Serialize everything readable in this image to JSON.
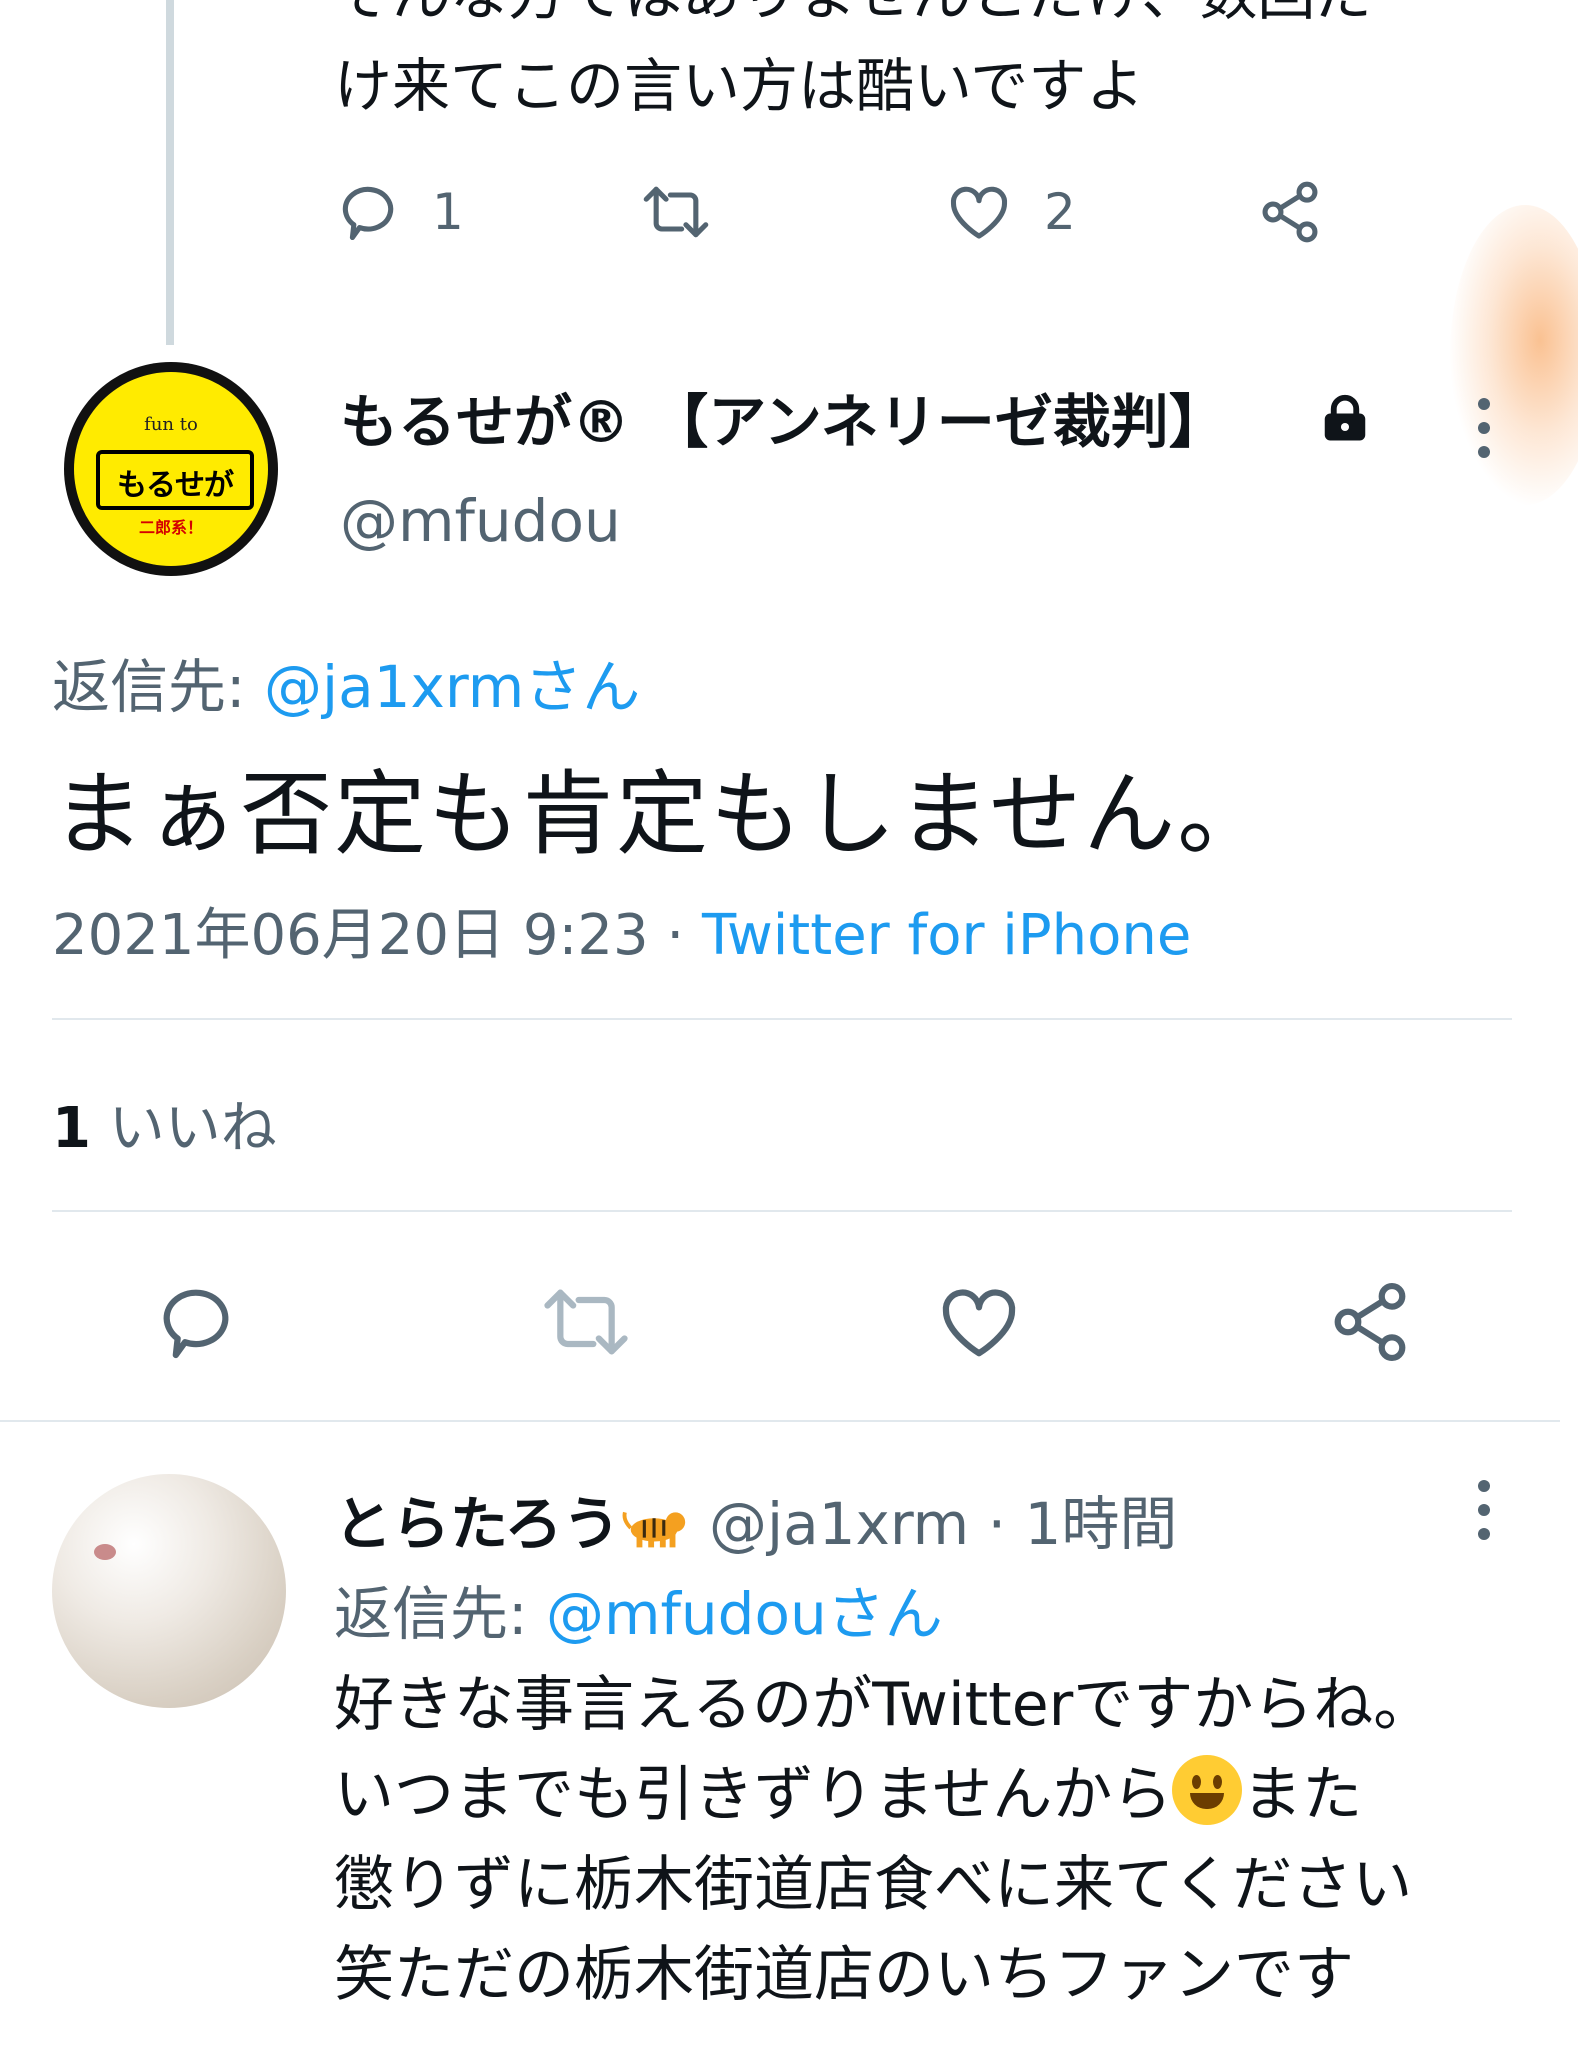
{
  "prev_tweet": {
    "lines": [
      "そんな方ではありませんとだけ、数回だ",
      "け来てこの言い方は酷いですよ"
    ],
    "reply_count": "1",
    "like_count": "2"
  },
  "main_tweet": {
    "display_name": "もるせが® 【アンネリーゼ裁判】",
    "handle": "@mfudou",
    "avatar_text": {
      "top": "fun to",
      "middle": "もるせが",
      "bottom": "二郎系！"
    },
    "reply_prefix": "返信先: ",
    "reply_to": "@ja1xrmさん",
    "text": "まぁ否定も肯定もしません。",
    "datetime": "2021年06月20日 9:23",
    "separator": " · ",
    "source": "Twitter for iPhone",
    "likes_count": "1",
    "likes_label": " いいね"
  },
  "reply_tweet": {
    "name": "とらたろう",
    "meta": " @ja1xrm · 1時間",
    "reply_prefix": "返信先: ",
    "reply_to": "@mfudouさん",
    "lines": [
      "好きな事言えるのがTwitterですからね。",
      "いつまでも引きずりませんから",
      "また",
      "懲りずに栃木街道店食べに来てください",
      "笑ただの栃木街道店のいちファンです"
    ]
  },
  "colors": {
    "accent": "#1d9bf0",
    "muted": "#536471",
    "divider": "#e1e8ed"
  },
  "icons": [
    "reply-icon",
    "retweet-icon",
    "like-icon",
    "share-icon",
    "lock-icon",
    "more-icon",
    "tiger-emoji",
    "smile-emoji"
  ]
}
